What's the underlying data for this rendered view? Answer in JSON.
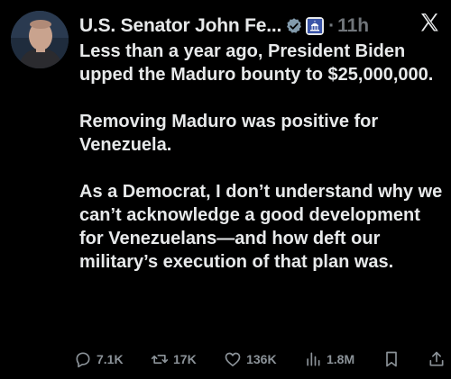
{
  "author": {
    "name": "U.S. Senator John Fe...",
    "separator": "·",
    "timestamp": "11h"
  },
  "tweet": {
    "paragraphs": [
      "Less than a year ago, President Biden upped the Maduro bounty to $25,000,000.",
      "Removing Maduro was positive for Venezuela.",
      "As a Democrat, I don’t understand why we can’t acknowledge a good development for Venezuelans—and how deft our military’s execution of that plan was."
    ]
  },
  "actions": {
    "replies": "7.1K",
    "reposts": "17K",
    "likes": "136K",
    "views": "1.8M"
  },
  "colors": {
    "background": "#000000",
    "text": "#e7e9ea",
    "muted": "#71767b",
    "verified_badge": "#829aab"
  },
  "icons": [
    "avatar",
    "verified-badge-icon",
    "government-badge-icon",
    "x-logo-icon",
    "reply-icon",
    "repost-icon",
    "like-icon",
    "views-icon",
    "bookmark-icon",
    "share-icon"
  ]
}
